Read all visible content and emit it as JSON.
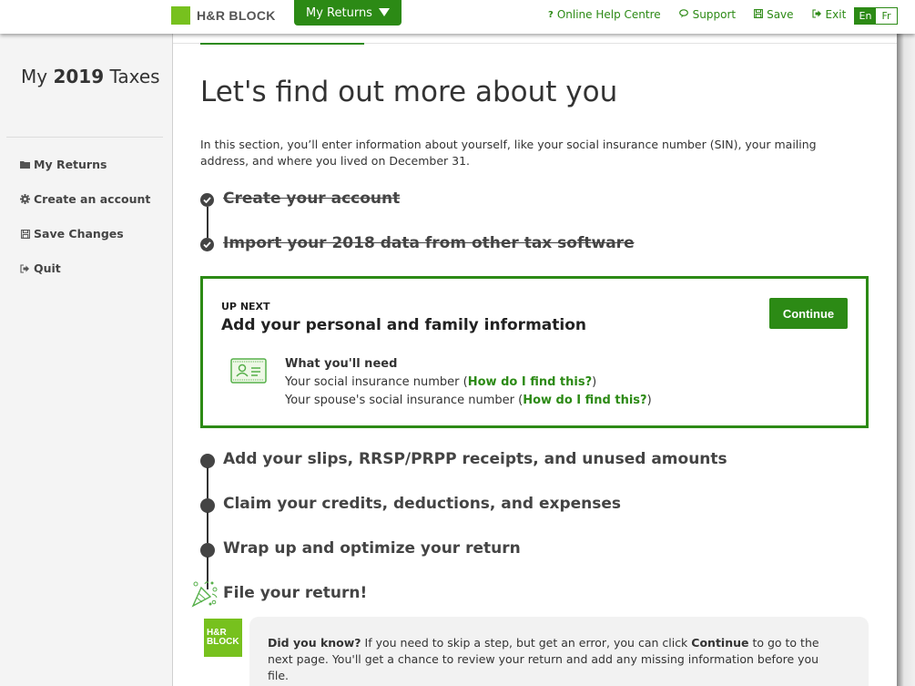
{
  "header": {
    "brand": "H&R BLOCK",
    "my_returns_label": "My Returns",
    "links": [
      {
        "icon": "question-icon",
        "glyph": "?",
        "label": "Online Help Centre"
      },
      {
        "icon": "chat-icon",
        "glyph": "🗨",
        "label": "Support"
      },
      {
        "icon": "save-icon",
        "glyph": "🖫",
        "label": "Save"
      },
      {
        "icon": "exit-icon",
        "glyph": "➜",
        "label": "Exit"
      }
    ],
    "lang": {
      "active": "En",
      "inactive": "Fr"
    }
  },
  "sidebar": {
    "title_pre": "My",
    "title_year": "2019",
    "title_post": "Taxes",
    "items": [
      {
        "icon": "folder-icon",
        "label": "My Returns"
      },
      {
        "icon": "gear-icon",
        "label": "Create an account"
      },
      {
        "icon": "save-icon",
        "label": "Save Changes"
      },
      {
        "icon": "exit-icon",
        "label": "Quit"
      }
    ]
  },
  "main": {
    "title": "Let's find out more about you",
    "intro": "In this section, you’ll enter information about yourself, like your social insurance number (SIN), your mailing address, and where you lived on December 31.",
    "completed_steps": [
      "Create your account",
      "Import your 2018 data from other tax software"
    ],
    "up_next": {
      "label": "UP NEXT",
      "title": "Add your personal and family information",
      "continue_label": "Continue",
      "need_heading": "What you'll need",
      "need_items": [
        {
          "text": "Your social insurance number (",
          "link": "How do I find this?",
          "after": ")"
        },
        {
          "text": "Your spouse's social insurance number (",
          "link": "How do I find this?",
          "after": ")"
        }
      ]
    },
    "upcoming_steps": [
      "Add your slips, RRSP/PRPP receipts, and unused amounts",
      "Claim your credits, deductions, and expenses",
      "Wrap up and optimize your return"
    ],
    "final_step": "File your return!",
    "tip": {
      "logo_line1": "H&R",
      "logo_line2": "BLOCK",
      "lead": "Did you know?",
      "text1": " If you need to skip a step, but get an error, you can click ",
      "bold": "Continue",
      "text2": " to go to the next page. You'll get a chance to review your return and add any missing information before you file."
    }
  },
  "colors": {
    "brand_green": "#2c8a15",
    "logo_green": "#77c11e"
  }
}
